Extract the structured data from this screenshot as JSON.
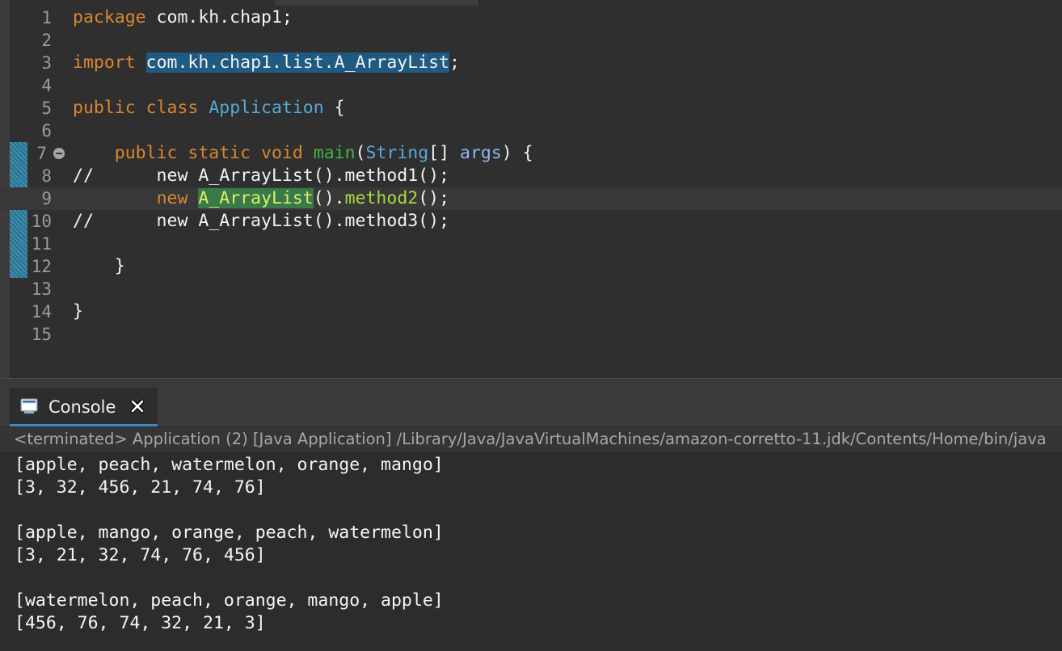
{
  "editor": {
    "lines": [
      {
        "n": "1"
      },
      {
        "n": "2"
      },
      {
        "n": "3"
      },
      {
        "n": "4"
      },
      {
        "n": "5"
      },
      {
        "n": "6"
      },
      {
        "n": "7"
      },
      {
        "n": "8"
      },
      {
        "n": "9"
      },
      {
        "n": "10"
      },
      {
        "n": "11"
      },
      {
        "n": "12"
      },
      {
        "n": "13"
      },
      {
        "n": "14"
      },
      {
        "n": "15"
      }
    ],
    "tokens": {
      "l1_kw": "package",
      "l1_rest": " com.kh.chap1;",
      "l3_kw": "import",
      "l3_sel": "com.kh.chap1.list.A_ArrayList",
      "l3_end": ";",
      "l5_kw1": "public",
      "l5_kw2": "class",
      "l5_type": "Application",
      "l5_end": " {",
      "l7_kw1": "public",
      "l7_kw2": "static",
      "l7_kw3": "void",
      "l7_method": "main",
      "l7_paren": "(",
      "l7_type": "String",
      "l7_arr": "[] ",
      "l7_var": "args",
      "l7_end": ") {",
      "l8_comment": "//      new A_ArrayList().method1();",
      "l9_kw": "new",
      "l9_occ": "A_ArrayList",
      "l9_mid": "().",
      "l9_call": "method2",
      "l9_end": "();",
      "l10_comment": "//      new A_ArrayList().method3();",
      "l12_brace": "}",
      "l14_brace": "}"
    }
  },
  "console": {
    "tab_label": "Console",
    "status": "<terminated> Application (2) [Java Application] /Library/Java/JavaVirtualMachines/amazon-corretto-11.jdk/Contents/Home/bin/java",
    "output": [
      "[apple, peach, watermelon, orange, mango]",
      "[3, 32, 456, 21, 74, 76]",
      "",
      "[apple, mango, orange, peach, watermelon]",
      "[3, 21, 32, 74, 76, 456]",
      "",
      "[watermelon, peach, orange, mango, apple]",
      "[456, 76, 74, 32, 21, 3]"
    ]
  },
  "colors": {
    "keyword": "#d78732",
    "type": "#58a8d8",
    "method_decl": "#3fb53f",
    "method_call": "#a7dc3c",
    "comment": "#7b7b7b",
    "selection": "#1f5a82",
    "tab_accent": "#3a8bc4"
  },
  "icons": {
    "fold": "collapse-minus-icon",
    "console": "console-monitor-icon",
    "close": "close-x-icon"
  }
}
